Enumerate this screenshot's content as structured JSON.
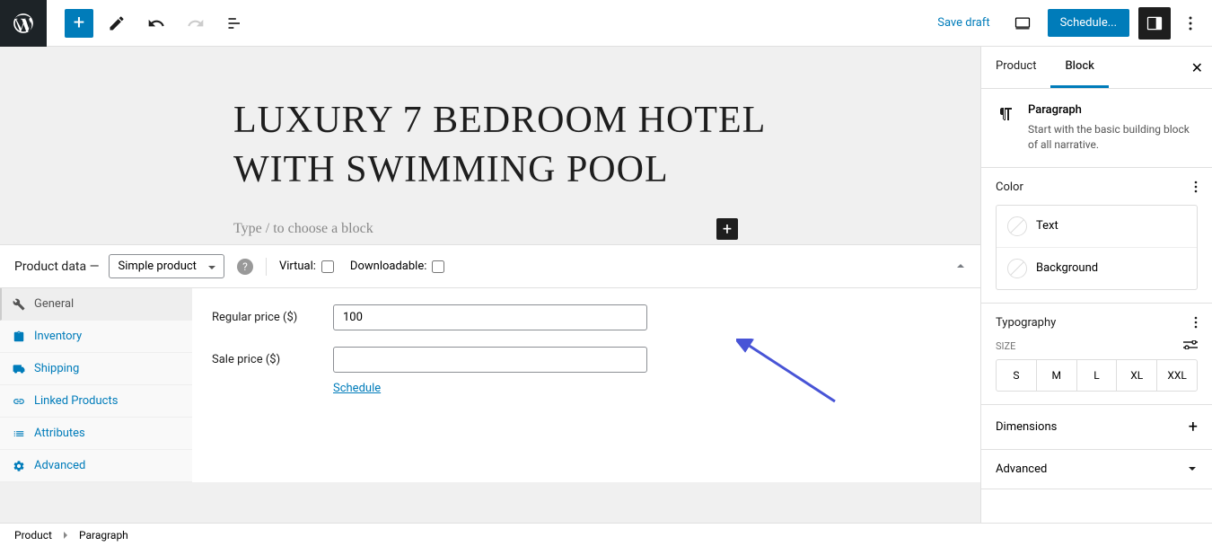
{
  "toolbar": {
    "save_draft": "Save draft",
    "schedule": "Schedule..."
  },
  "editor": {
    "title": "LUXURY 7 BEDROOM HOTEL WITH SWIMMING POOL",
    "block_placeholder": "Type / to choose a block"
  },
  "product_data": {
    "label": "Product data —",
    "select_value": "Simple product",
    "virtual_label": "Virtual:",
    "downloadable_label": "Downloadable:",
    "tabs": [
      {
        "key": "general",
        "label": "General"
      },
      {
        "key": "inventory",
        "label": "Inventory"
      },
      {
        "key": "shipping",
        "label": "Shipping"
      },
      {
        "key": "linked",
        "label": "Linked Products"
      },
      {
        "key": "attributes",
        "label": "Attributes"
      },
      {
        "key": "advanced",
        "label": "Advanced"
      }
    ],
    "regular_price_label": "Regular price ($)",
    "regular_price_value": "100",
    "sale_price_label": "Sale price ($)",
    "sale_price_value": "",
    "schedule_link": "Schedule"
  },
  "sidebar": {
    "tabs": {
      "product": "Product",
      "block": "Block"
    },
    "block_info": {
      "title": "Paragraph",
      "desc": "Start with the basic building block of all narrative."
    },
    "color": {
      "title": "Color",
      "text_label": "Text",
      "background_label": "Background"
    },
    "typography": {
      "title": "Typography",
      "size_label": "SIZE",
      "sizes": [
        "S",
        "M",
        "L",
        "XL",
        "XXL"
      ]
    },
    "dimensions_title": "Dimensions",
    "advanced_title": "Advanced"
  },
  "breadcrumb": {
    "product": "Product",
    "paragraph": "Paragraph"
  }
}
